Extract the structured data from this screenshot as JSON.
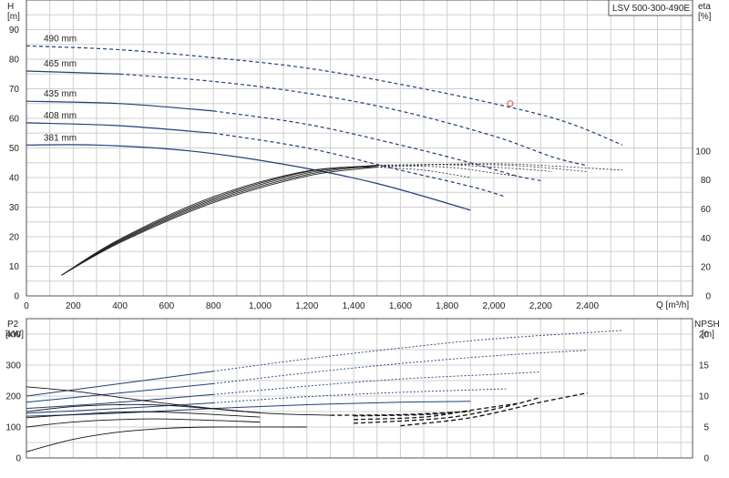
{
  "title_box": "LSV 500-300-490E",
  "chart_data": [
    {
      "type": "line",
      "name": "head-efficiency",
      "xlabel": "Q [m³/h]",
      "ylabel": "H",
      "ylabel_unit": "[m]",
      "y2label": "eta",
      "y2label_unit": "[%]",
      "xlim": [
        0,
        2850
      ],
      "ylim": [
        0,
        100
      ],
      "y2lim": [
        0,
        100
      ],
      "x_ticks": [
        0,
        200,
        400,
        600,
        800,
        1000,
        1200,
        1400,
        1600,
        1800,
        2000,
        2200,
        2400
      ],
      "x_tick_labels": [
        "0",
        "200",
        "400",
        "600",
        "800",
        "1,000",
        "1,200",
        "1,400",
        "1,600",
        "1,800",
        "2,000",
        "2,200",
        "2,400"
      ],
      "y_ticks": [
        0,
        10,
        20,
        30,
        40,
        50,
        60,
        70,
        80,
        90
      ],
      "y2_ticks": [
        0,
        20,
        40,
        60,
        80,
        100
      ],
      "y2_zero_at_h": 0,
      "y2_100_at_h": 49,
      "grid": true,
      "head_series": [
        {
          "label": "490 mm",
          "points": [
            [
              0,
              84.5
            ],
            [
              400,
              83.2
            ],
            [
              800,
              80.5
            ],
            [
              1200,
              77
            ],
            [
              1600,
              71.5
            ],
            [
              2000,
              65
            ],
            [
              2300,
              59
            ],
            [
              2550,
              51
            ]
          ],
          "solid_until": 0
        },
        {
          "label": "465 mm",
          "points": [
            [
              0,
              76
            ],
            [
              400,
              75
            ],
            [
              800,
              72.5
            ],
            [
              1200,
              68.5
            ],
            [
              1600,
              62.5
            ],
            [
              2000,
              54
            ],
            [
              2250,
              47
            ],
            [
              2400,
              44
            ]
          ],
          "solid_until": 400
        },
        {
          "label": "435 mm",
          "points": [
            [
              0,
              65.8
            ],
            [
              400,
              65
            ],
            [
              800,
              62.5
            ],
            [
              1200,
              58
            ],
            [
              1600,
              51
            ],
            [
              1900,
              45
            ],
            [
              2100,
              40.5
            ],
            [
              2200,
              39
            ]
          ],
          "solid_until": 800
        },
        {
          "label": "408 mm",
          "points": [
            [
              0,
              58.5
            ],
            [
              400,
              57.5
            ],
            [
              800,
              55
            ],
            [
              1200,
              50
            ],
            [
              1600,
              42.5
            ],
            [
              1900,
              37
            ],
            [
              2050,
              33.5
            ]
          ],
          "solid_until": 1000
        },
        {
          "label": "381 mm",
          "points": [
            [
              0,
              51
            ],
            [
              300,
              51
            ],
            [
              700,
              49
            ],
            [
              1100,
              44.5
            ],
            [
              1500,
              38
            ],
            [
              1900,
              29
            ]
          ],
          "solid_until": 1900
        }
      ],
      "eta_series": [
        {
          "points": [
            [
              150,
              7
            ],
            [
              400,
              18
            ],
            [
              800,
              31.5
            ],
            [
              1200,
              40.5
            ],
            [
              1500,
              43.5
            ],
            [
              1800,
              44.5
            ],
            [
              2100,
              44.5
            ],
            [
              2550,
              42.5
            ]
          ]
        },
        {
          "points": [
            [
              150,
              7
            ],
            [
              400,
              18.3
            ],
            [
              800,
              32
            ],
            [
              1200,
              41
            ],
            [
              1500,
              44
            ],
            [
              1800,
              44.5
            ],
            [
              2100,
              44
            ],
            [
              2400,
              42
            ]
          ]
        },
        {
          "points": [
            [
              150,
              7
            ],
            [
              400,
              18.6
            ],
            [
              800,
              32.5
            ],
            [
              1200,
              41.5
            ],
            [
              1500,
              44.2
            ],
            [
              1800,
              44.3
            ],
            [
              2100,
              43
            ],
            [
              2250,
              42
            ]
          ]
        },
        {
          "points": [
            [
              150,
              7
            ],
            [
              400,
              18.9
            ],
            [
              800,
              33
            ],
            [
              1200,
              42
            ],
            [
              1500,
              44
            ],
            [
              1800,
              43.5
            ],
            [
              2000,
              41.5
            ],
            [
              2100,
              40.5
            ]
          ]
        },
        {
          "points": [
            [
              150,
              7
            ],
            [
              400,
              19.2
            ],
            [
              800,
              33.5
            ],
            [
              1200,
              42.2
            ],
            [
              1500,
              43.5
            ],
            [
              1700,
              42.5
            ],
            [
              1900,
              40
            ]
          ]
        }
      ],
      "duty_point": [
        2070,
        65
      ]
    },
    {
      "type": "line",
      "name": "power-npsh",
      "ylabel": "P2",
      "ylabel_unit": "[kW]",
      "y2label": "NPSH",
      "y2label_unit": "[m]",
      "xlim": [
        0,
        2850
      ],
      "ylim": [
        0,
        450
      ],
      "y2lim": [
        0,
        22.5
      ],
      "y_ticks": [
        0,
        100,
        200,
        300,
        400
      ],
      "y2_ticks": [
        0,
        5,
        10,
        15,
        20
      ],
      "grid": true,
      "power_series": [
        {
          "points": [
            [
              0,
              200
            ],
            [
              400,
              240
            ],
            [
              800,
              280
            ],
            [
              1200,
              320
            ],
            [
              1600,
              355
            ],
            [
              2000,
              385
            ],
            [
              2550,
              412
            ]
          ]
        },
        {
          "points": [
            [
              0,
              180
            ],
            [
              400,
              210
            ],
            [
              800,
              240
            ],
            [
              1200,
              275
            ],
            [
              1600,
              305
            ],
            [
              2000,
              330
            ],
            [
              2400,
              348
            ]
          ]
        },
        {
          "points": [
            [
              0,
              160
            ],
            [
              400,
              180
            ],
            [
              800,
              205
            ],
            [
              1200,
              232
            ],
            [
              1600,
              255
            ],
            [
              2000,
              270
            ],
            [
              2200,
              278
            ]
          ]
        },
        {
          "points": [
            [
              0,
              145
            ],
            [
              400,
              160
            ],
            [
              800,
              178
            ],
            [
              1200,
              198
            ],
            [
              1600,
              212
            ],
            [
              2000,
              222
            ],
            [
              2050,
              223
            ]
          ]
        },
        {
          "points": [
            [
              0,
              135
            ],
            [
              400,
              145
            ],
            [
              800,
              160
            ],
            [
              1200,
              172
            ],
            [
              1600,
              180
            ],
            [
              1900,
              183
            ]
          ]
        }
      ],
      "npsh_series": [
        {
          "points": [
            [
              0,
              1
            ],
            [
              200,
              3
            ],
            [
              400,
              4.2
            ],
            [
              600,
              4.8
            ],
            [
              800,
              5
            ],
            [
              1200,
              5
            ],
            [
              1600,
              5.2
            ],
            [
              1900,
              6.5
            ],
            [
              2200,
              9
            ],
            [
              2400,
              10.5
            ]
          ]
        },
        {
          "points": [
            [
              0,
              5
            ],
            [
              200,
              5.8
            ],
            [
              400,
              6.2
            ],
            [
              600,
              6.3
            ],
            [
              1000,
              5.8
            ],
            [
              1400,
              5.6
            ],
            [
              1800,
              6.5
            ],
            [
              2050,
              8.3
            ],
            [
              2200,
              9.8
            ]
          ]
        },
        {
          "points": [
            [
              0,
              6.5
            ],
            [
              200,
              7
            ],
            [
              400,
              7.4
            ],
            [
              600,
              7.4
            ],
            [
              1000,
              6.6
            ],
            [
              1400,
              6.2
            ],
            [
              1700,
              6.6
            ],
            [
              1900,
              7.7
            ],
            [
              2100,
              8.8
            ]
          ]
        },
        {
          "points": [
            [
              0,
              7.5
            ],
            [
              200,
              8.3
            ],
            [
              400,
              8.6
            ],
            [
              600,
              8.5
            ],
            [
              1000,
              7.3
            ],
            [
              1400,
              6.8
            ],
            [
              1700,
              7
            ],
            [
              1900,
              7.6
            ]
          ]
        },
        {
          "points": [
            [
              0,
              11.5
            ],
            [
              200,
              10.8
            ],
            [
              400,
              9.8
            ],
            [
              600,
              8.8
            ],
            [
              1000,
              7.3
            ],
            [
              1300,
              6.9
            ],
            [
              1600,
              7
            ],
            [
              1900,
              7.5
            ]
          ]
        }
      ]
    }
  ]
}
